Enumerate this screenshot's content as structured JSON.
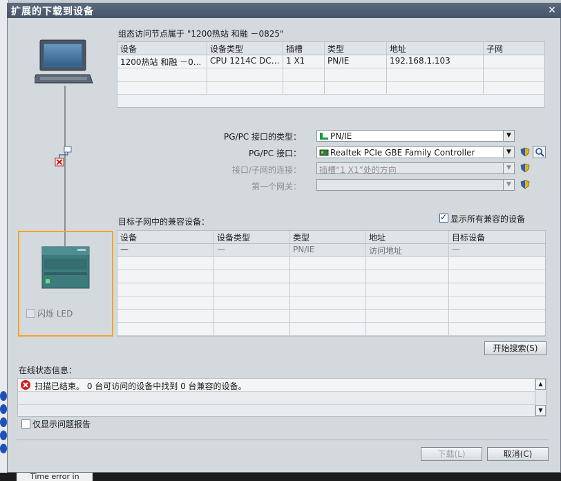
{
  "window": {
    "title": "扩展的下载到设备"
  },
  "config_section": {
    "caption": "组态访问节点属于 \"1200热站 和融 －0825\"",
    "columns": [
      "设备",
      "设备类型",
      "插槽",
      "类型",
      "地址",
      "子网"
    ],
    "rows": [
      [
        "1200热站 和融 －0...",
        "CPU 1214C DC/D...",
        "1 X1",
        "PN/IE",
        "192.168.1.103",
        ""
      ]
    ]
  },
  "interface": {
    "pgpc_type_label": "PG/PC 接口的类型：",
    "pgpc_type_value": "PN/IE",
    "pgpc_if_label": "PG/PC 接口：",
    "pgpc_if_value": "Realtek PCIe GBE Family Controller",
    "connection_label": "接口/子网的连接：",
    "connection_value": "插槽“1 X1”处的方向",
    "gateway_label": "第一个网关：",
    "gateway_value": ""
  },
  "target_section": {
    "caption": "目标子网中的兼容设备：",
    "show_all_label": "显示所有兼容的设备",
    "show_all_checked": true,
    "columns": [
      "设备",
      "设备类型",
      "类型",
      "地址",
      "目标设备"
    ],
    "rows": [
      [
        "—",
        "—",
        "PN/IE",
        "访问地址",
        "—"
      ]
    ]
  },
  "device_panel": {
    "flash_led_label": "闪烁 LED"
  },
  "buttons": {
    "start_search": "开始搜索(S)",
    "download": "下载(L)",
    "cancel": "取消(C)"
  },
  "status": {
    "caption": "在线状态信息：",
    "message": "扫描已结束。 0 台可访问的设备中找到 0 台兼容的设备。",
    "only_problems_label": "仅显示问题报告"
  },
  "taskbar": {
    "item": "Time error in"
  },
  "colors": {
    "highlight": "#f3a324",
    "error": "#d21f1f",
    "titlebar": "#4e5e72"
  }
}
